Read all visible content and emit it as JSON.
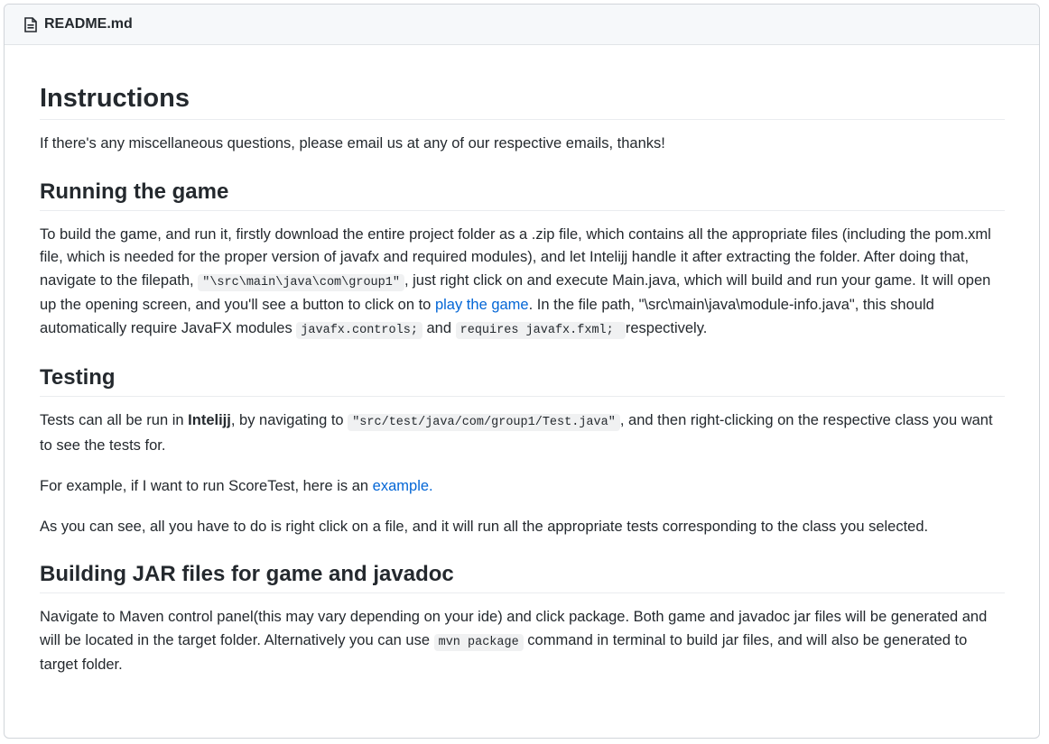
{
  "header": {
    "file_name": "README.md"
  },
  "instructions": {
    "title": "Instructions",
    "intro": "If there's any miscellaneous questions, please email us at any of our respective emails, thanks!"
  },
  "running": {
    "title": "Running the game",
    "text1": "To build the game, and run it, firstly download the entire project folder as a .zip file, which contains all the appropriate files (including the pom.xml file, which is needed for the proper version of javafx and required modules), and let Intelijj handle it after extracting the folder. After doing that, navigate to the filepath, ",
    "code1": "\"\\src\\main\\java\\com\\group1\"",
    "text2": ", just right click on and execute Main.java, which will build and run your game. It will open up the opening screen, and you'll see a button to click on to ",
    "link": "play the game",
    "text3": ". In the file path, \"\\src\\main\\java\\module-info.java\", this should automatically require JavaFX modules ",
    "code2": "javafx.controls;",
    "text4": " and ",
    "code3": "requires javafx.fxml; ",
    "text5": " respectively."
  },
  "testing": {
    "title": "Testing",
    "p1_a": "Tests can all be run in ",
    "p1_bold": "Intelijj",
    "p1_b": ", by navigating to ",
    "p1_code": "\"src/test/java/com/group1/Test.java\"",
    "p1_c": ", and then right-clicking on the respective class you want to see the tests for.",
    "p2_a": "For example, if I want to run ScoreTest, here is an ",
    "p2_link": "example.",
    "p3": "As you can see, all you have to do is right click on a file, and it will run all the appropriate tests corresponding to the class you selected."
  },
  "building": {
    "title": "Building JAR files for game and javadoc",
    "text1": "Navigate to Maven control panel(this may vary depending on your ide) and click package. Both game and javadoc jar files will be generated and will be located in the target folder. Alternatively you can use ",
    "code": "mvn package",
    "text2": " command in terminal to build jar files, and will also be generated to target folder."
  },
  "icons": {
    "file": "file-icon"
  },
  "colors": {
    "link": "#0366d6",
    "header_bg": "#f6f8fa",
    "code_bg": "#f0f1f2"
  }
}
